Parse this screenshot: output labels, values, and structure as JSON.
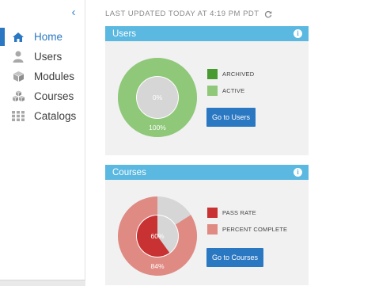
{
  "sidebar": {
    "collapse_icon": "chevron-left-icon",
    "items": [
      {
        "label": "Home",
        "icon": "home-icon",
        "active": true
      },
      {
        "label": "Users",
        "icon": "user-icon",
        "active": false
      },
      {
        "label": "Modules",
        "icon": "cube-icon",
        "active": false
      },
      {
        "label": "Courses",
        "icon": "cubes-icon",
        "active": false
      },
      {
        "label": "Catalogs",
        "icon": "grid-icon",
        "active": false
      }
    ]
  },
  "header": {
    "last_updated": "LAST UPDATED TODAY AT 4:19 PM PDT",
    "refresh_icon": "refresh-icon"
  },
  "users_panel": {
    "title": "Users",
    "button_label": "Go to Users",
    "legend": [
      {
        "label": "ARCHIVED",
        "color": "#4a9a32"
      },
      {
        "label": "ACTIVE",
        "color": "#8ec878"
      }
    ]
  },
  "courses_panel": {
    "title": "Courses",
    "button_label": "Go to Courses",
    "legend": [
      {
        "label": "PASS RATE",
        "color": "#c83232"
      },
      {
        "label": "PERCENT COMPLETE",
        "color": "#e08a84"
      }
    ]
  },
  "colors": {
    "accent": "#2b78c2",
    "panel_header": "#5bb8e0",
    "remainder": "#d6d6d6"
  },
  "chart_data": [
    {
      "type": "pie",
      "id": "users",
      "series": [
        {
          "name": "ARCHIVED",
          "values": [
            0
          ],
          "label": "0%"
        },
        {
          "name": "ACTIVE",
          "values": [
            100
          ],
          "label": "100%"
        }
      ]
    },
    {
      "type": "pie",
      "id": "courses",
      "series": [
        {
          "name": "PASS RATE",
          "values": [
            60
          ],
          "label": "60%"
        },
        {
          "name": "PERCENT COMPLETE",
          "values": [
            84
          ],
          "label": "84%"
        }
      ]
    }
  ]
}
